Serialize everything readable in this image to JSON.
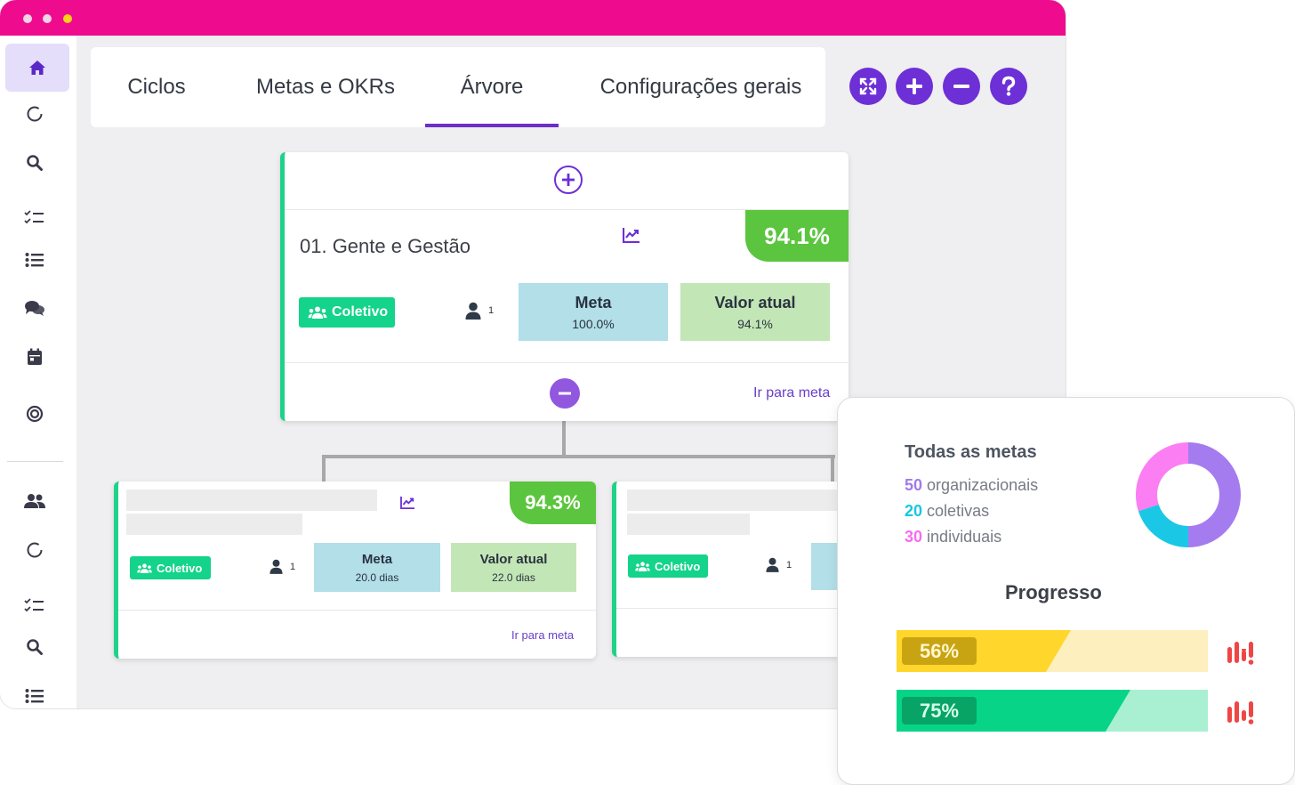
{
  "window": {
    "dots": [
      "close",
      "minimize",
      "maximize"
    ]
  },
  "sidebar": {
    "items": [
      {
        "icon": "home-icon",
        "active": true
      },
      {
        "icon": "cycle-icon"
      },
      {
        "icon": "search-icon"
      },
      {
        "icon": "checklist-icon"
      },
      {
        "icon": "list-icon"
      },
      {
        "icon": "chat-icon"
      },
      {
        "icon": "calendar-icon"
      },
      {
        "icon": "target-icon"
      },
      {
        "icon": "users-icon"
      },
      {
        "icon": "cycle-icon"
      },
      {
        "icon": "checklist-icon"
      },
      {
        "icon": "search-icon"
      },
      {
        "icon": "list-icon"
      }
    ]
  },
  "tabs": [
    {
      "label": "Ciclos"
    },
    {
      "label": "Metas e OKRs"
    },
    {
      "label": "Árvore",
      "active": true
    },
    {
      "label": "Configurações gerais"
    }
  ],
  "controls": [
    {
      "icon": "expand-icon"
    },
    {
      "icon": "plus-icon"
    },
    {
      "icon": "minus-icon"
    },
    {
      "icon": "help-icon"
    }
  ],
  "main_card": {
    "title": "01. Gente e Gestão",
    "percent": "94.1%",
    "chip": "Coletivo",
    "people": "1",
    "meta_label": "Meta",
    "meta_value": "100.0%",
    "current_label": "Valor atual",
    "current_value": "94.1%",
    "link": "Ir para meta"
  },
  "child_cards": [
    {
      "percent": "94.3%",
      "chip": "Coletivo",
      "people": "1",
      "meta_label": "Meta",
      "meta_value": "20.0 dias",
      "current_label": "Valor atual",
      "current_value": "22.0 dias",
      "link": "Ir para meta"
    },
    {
      "chip": "Coletivo",
      "people": "1"
    }
  ],
  "stats": {
    "title": "Todas as metas",
    "items": [
      {
        "count": "50",
        "label": "organizacionais",
        "color": "#a07ae8"
      },
      {
        "count": "20",
        "label": "coletivas",
        "color": "#18c7e0"
      },
      {
        "count": "30",
        "label": "individuais",
        "color": "#f56cf0"
      }
    ],
    "donut": [
      {
        "label": "organizacionais",
        "value": 50,
        "color": "#a47cf0"
      },
      {
        "label": "coletivas",
        "value": 20,
        "color": "#1ac8e6"
      },
      {
        "label": "individuais",
        "value": 30,
        "color": "#fb7ef3"
      }
    ],
    "progress_title": "Progresso",
    "bars": [
      {
        "label": "56%",
        "value": 0.56,
        "fill": "#ffd62c",
        "track": "#fdf0be",
        "badge": "#c9a412",
        "text": "#fff7d0"
      },
      {
        "label": "75%",
        "value": 0.75,
        "fill": "#08d487",
        "track": "#a9f0d2",
        "badge": "#07a466",
        "text": "#d4ffe9"
      }
    ]
  },
  "colors": {
    "brand_pink": "#ee0b8e",
    "accent_purple": "#6d2fd6",
    "success_green": "#5cc53f"
  }
}
